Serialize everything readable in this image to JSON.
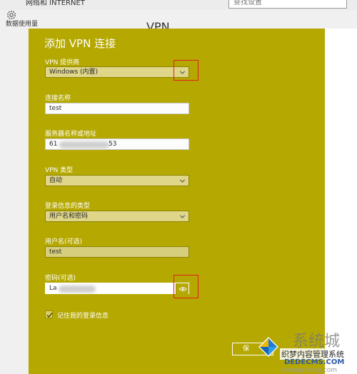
{
  "background": {
    "breadcrumb": "网络和 INTERNET",
    "search_placeholder": "查找设置",
    "left_item": "数据使用量",
    "right_heading": "VPN"
  },
  "dialog": {
    "title": "添加 VPN 连接",
    "provider": {
      "label": "VPN 提供商",
      "value": "Windows (内置)"
    },
    "connection_name": {
      "label": "连接名称",
      "value": "test"
    },
    "server": {
      "label": "服务器名称或地址",
      "value_prefix": "61",
      "value_suffix": "53"
    },
    "vpn_type": {
      "label": "VPN 类型",
      "value": "自动"
    },
    "signin_type": {
      "label": "登录信息的类型",
      "value": "用户名和密码"
    },
    "username": {
      "label": "用户名(可选)",
      "value": "test"
    },
    "password": {
      "label": "密码(可选)",
      "value_prefix": "La"
    },
    "remember": {
      "label": "记住我的登录信息",
      "checked": true
    },
    "save_label": "保"
  },
  "watermark": {
    "big_text": "系统城",
    "line1": "织梦内容管理系统",
    "line2": "DEDECMS.COM",
    "line3": "xitongcheng.com"
  },
  "colors": {
    "dialog_bg": "#b5a800",
    "highlight": "#e51e1e"
  }
}
